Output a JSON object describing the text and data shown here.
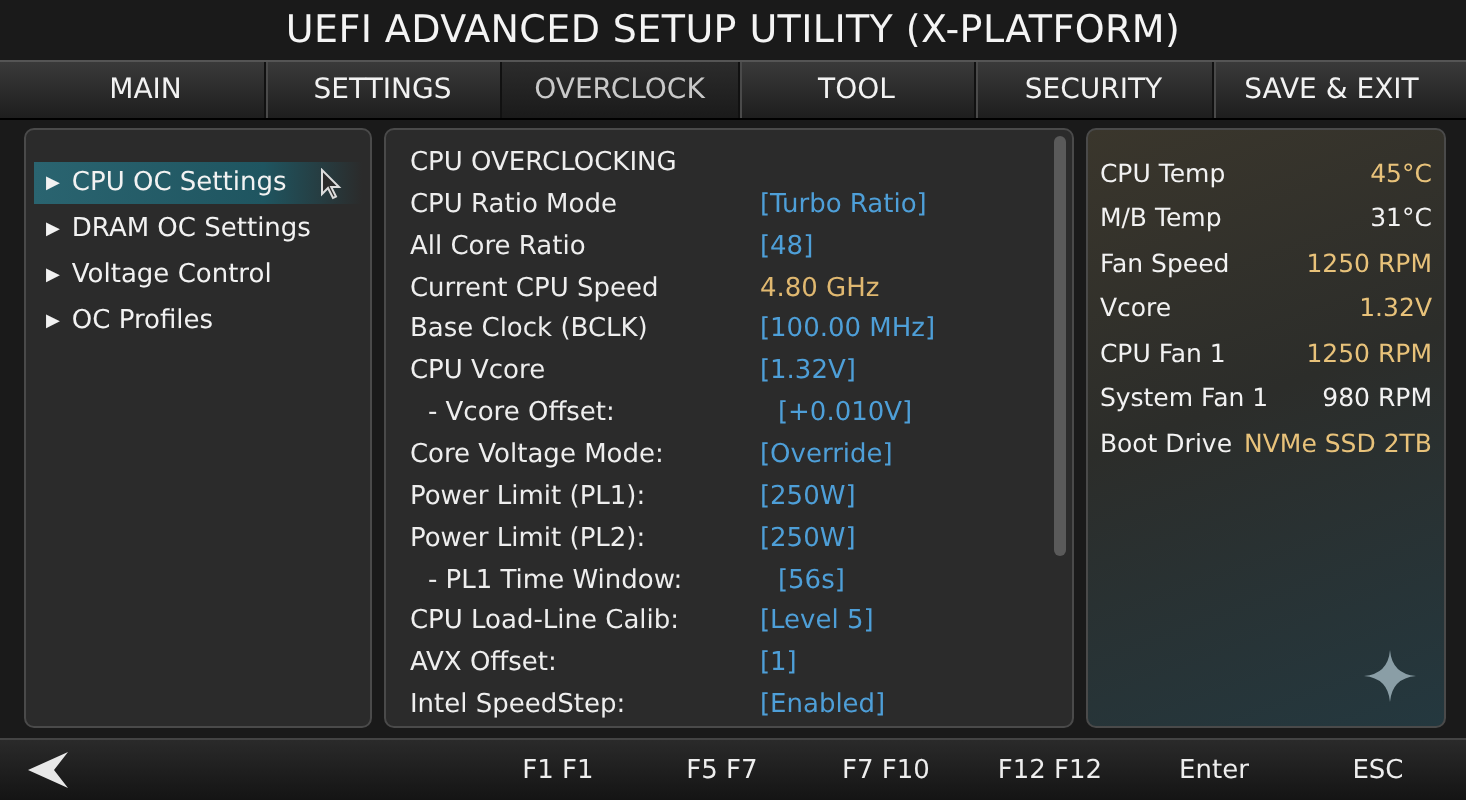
{
  "window": {
    "title": "UEFI ADVANCED SETUP UTILITY (X-PLATFORM)"
  },
  "tabs": [
    {
      "label": "MAIN",
      "selected": false
    },
    {
      "label": "SETTINGS",
      "selected": false
    },
    {
      "label": "OVERCLOCK",
      "selected": true
    },
    {
      "label": "TOOL",
      "selected": false
    },
    {
      "label": "SECURITY",
      "selected": false
    },
    {
      "label": "SAVE & EXIT",
      "selected": false
    }
  ],
  "sidebar": {
    "items": [
      {
        "label": "▶",
        "text": "CPU OC Settings",
        "selected": true
      },
      {
        "label": "▶",
        "text": "DRAM OC Settings",
        "selected": false
      },
      {
        "label": "▶",
        "text": "Voltage Control",
        "selected": false
      },
      {
        "label": "▶",
        "text": "OC Profiles",
        "selected": false
      }
    ]
  },
  "settings": {
    "heading": "CPU OVERCLOCKING",
    "rows": [
      {
        "name": "CPU Ratio Mode",
        "value": "[Turbo Ratio]",
        "kind": "option"
      },
      {
        "name": "All Core Ratio",
        "value": "[48]",
        "kind": "option"
      },
      {
        "name": "Current CPU Speed",
        "value": "4.80 GHz",
        "kind": "readout"
      },
      {
        "name": "Base Clock (BCLK)",
        "value": "[100.00 MHz]",
        "kind": "option"
      },
      {
        "name": "CPU Vcore",
        "value": "[1.32V]",
        "kind": "option"
      },
      {
        "name": "- Vcore Offset:",
        "value": "[+0.010V]",
        "kind": "option",
        "sub": true
      },
      {
        "name": "Core Voltage Mode:",
        "value": "[Override]",
        "kind": "option"
      },
      {
        "name": "Power Limit (PL1):",
        "value": "[250W]",
        "kind": "option"
      },
      {
        "name": "Power Limit (PL2):",
        "value": "[250W]",
        "kind": "option"
      },
      {
        "name": "- PL1 Time Window:",
        "value": "[56s]",
        "kind": "option",
        "sub": true
      },
      {
        "name": "CPU Load-Line Calib:",
        "value": "[Level 5]",
        "kind": "option"
      },
      {
        "name": "AVX Offset:",
        "value": "[1]",
        "kind": "option"
      },
      {
        "name": "Intel SpeedStep:",
        "value": "[Enabled]",
        "kind": "option"
      }
    ]
  },
  "monitor": {
    "items": [
      {
        "label": "CPU Temp",
        "value": "45°C",
        "color": "#e8c27a"
      },
      {
        "label": "M/B Temp",
        "value": "31°C",
        "color": "#f2f2f2"
      },
      {
        "label": "Fan Speed",
        "value": "1250 RPM",
        "color": "#e8c27a"
      },
      {
        "label": "Vcore",
        "value": "1.32V",
        "color": "#e8c27a"
      },
      {
        "label": "CPU Fan 1",
        "value": "1250 RPM",
        "color": "#e8c27a"
      },
      {
        "label": "System Fan 1",
        "value": "980 RPM",
        "color": "#f2f2f2"
      },
      {
        "label": "Boot Drive",
        "value": "NVMe SSD 2TB",
        "color": "#e8c27a"
      }
    ]
  },
  "footer": {
    "keys": [
      "F1 F1",
      "F5 F7",
      "F7 F10",
      "F12 F12",
      "Enter",
      "ESC"
    ]
  }
}
